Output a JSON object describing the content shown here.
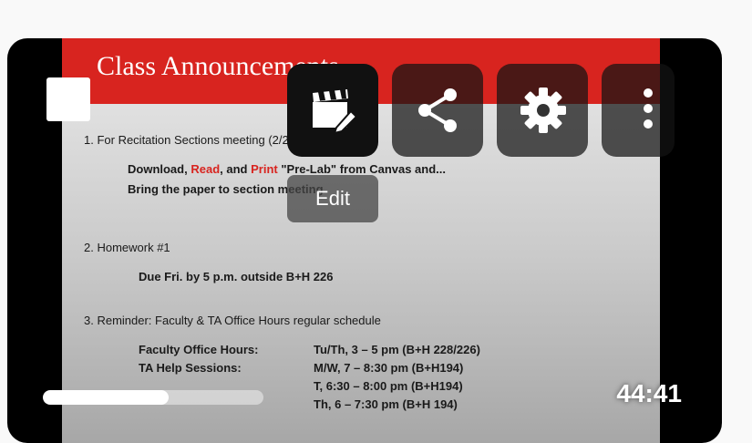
{
  "slide": {
    "title": "Class Announcements",
    "item1": "1. For Recitation Sections meeting (2/20 and 9/22):",
    "item1_download": "Download,",
    "item1_read": "Read",
    "item1_and": ", and",
    "item1_print": "Print",
    "item1_rest": "\"Pre-Lab\" from Canvas and...",
    "item1_line2": "Bring the paper to section meeting",
    "item2": "2. Homework #1",
    "item2_detail": "Due Fri. by 5 p.m. outside B+H 226",
    "item3": "3. Reminder: Faculty & TA Office Hours regular schedule",
    "faculty_label": "Faculty Office Hours:",
    "faculty_value": "Tu/Th, 3 – 5 pm (B+H 228/226)",
    "ta_label": "TA Help Sessions:",
    "ta_value1": "M/W, 7 – 8:30 pm (B+H194)",
    "ta_value2": "T, 6:30 – 8:00 pm (B+H194)",
    "ta_value3": "Th, 6 – 7:30 pm (B+H 194)"
  },
  "overlay": {
    "edit_tooltip": "Edit",
    "buttons": [
      "edit-icon",
      "share-icon",
      "gear-icon",
      "more-vert-icon"
    ]
  },
  "player": {
    "duration": "44:41",
    "progress_fraction": 0.57
  },
  "colors": {
    "slide_red": "#d8241f",
    "card_bg": "#000000"
  }
}
